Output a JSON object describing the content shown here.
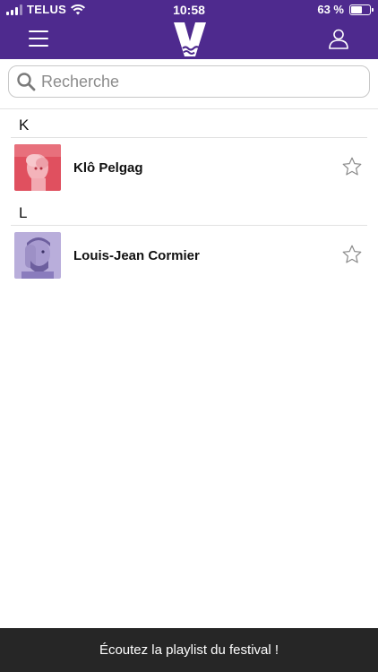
{
  "status_bar": {
    "carrier": "TELUS",
    "time": "10:58",
    "battery_text": "63 %",
    "battery_level": 0.63
  },
  "nav": {
    "menu_icon": "hamburger-menu-icon",
    "logo_icon": "v-festival-logo",
    "profile_icon": "user-profile-icon"
  },
  "search": {
    "placeholder": "Recherche",
    "value": ""
  },
  "sections": [
    {
      "letter": "K",
      "artists": [
        {
          "name": "Klô Pelgag",
          "favorite": false
        }
      ]
    },
    {
      "letter": "L",
      "artists": [
        {
          "name": "Louis-Jean Cormier",
          "favorite": false
        }
      ]
    }
  ],
  "bottom_bar": {
    "label": "Écoutez la playlist du festival !"
  },
  "colors": {
    "header_purple": "#4e2a8e",
    "bottom_bar": "#262626",
    "thumb_red": "#e0505f",
    "thumb_lavender": "#b9aedb"
  }
}
